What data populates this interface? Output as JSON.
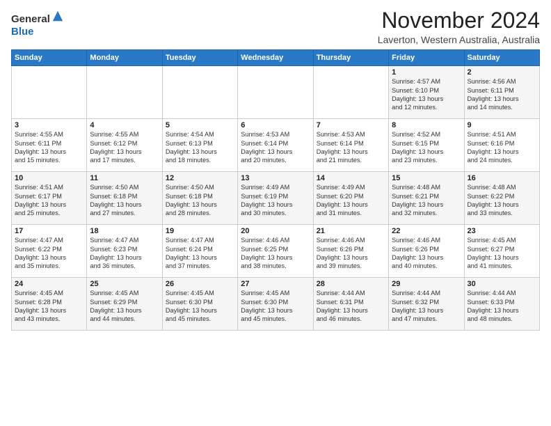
{
  "header": {
    "logo_line1": "General",
    "logo_line2": "Blue",
    "title": "November 2024",
    "subtitle": "Laverton, Western Australia, Australia"
  },
  "columns": [
    "Sunday",
    "Monday",
    "Tuesday",
    "Wednesday",
    "Thursday",
    "Friday",
    "Saturday"
  ],
  "weeks": [
    [
      {
        "day": "",
        "info": ""
      },
      {
        "day": "",
        "info": ""
      },
      {
        "day": "",
        "info": ""
      },
      {
        "day": "",
        "info": ""
      },
      {
        "day": "",
        "info": ""
      },
      {
        "day": "1",
        "info": "Sunrise: 4:57 AM\nSunset: 6:10 PM\nDaylight: 13 hours\nand 12 minutes."
      },
      {
        "day": "2",
        "info": "Sunrise: 4:56 AM\nSunset: 6:11 PM\nDaylight: 13 hours\nand 14 minutes."
      }
    ],
    [
      {
        "day": "3",
        "info": "Sunrise: 4:55 AM\nSunset: 6:11 PM\nDaylight: 13 hours\nand 15 minutes."
      },
      {
        "day": "4",
        "info": "Sunrise: 4:55 AM\nSunset: 6:12 PM\nDaylight: 13 hours\nand 17 minutes."
      },
      {
        "day": "5",
        "info": "Sunrise: 4:54 AM\nSunset: 6:13 PM\nDaylight: 13 hours\nand 18 minutes."
      },
      {
        "day": "6",
        "info": "Sunrise: 4:53 AM\nSunset: 6:14 PM\nDaylight: 13 hours\nand 20 minutes."
      },
      {
        "day": "7",
        "info": "Sunrise: 4:53 AM\nSunset: 6:14 PM\nDaylight: 13 hours\nand 21 minutes."
      },
      {
        "day": "8",
        "info": "Sunrise: 4:52 AM\nSunset: 6:15 PM\nDaylight: 13 hours\nand 23 minutes."
      },
      {
        "day": "9",
        "info": "Sunrise: 4:51 AM\nSunset: 6:16 PM\nDaylight: 13 hours\nand 24 minutes."
      }
    ],
    [
      {
        "day": "10",
        "info": "Sunrise: 4:51 AM\nSunset: 6:17 PM\nDaylight: 13 hours\nand 25 minutes."
      },
      {
        "day": "11",
        "info": "Sunrise: 4:50 AM\nSunset: 6:18 PM\nDaylight: 13 hours\nand 27 minutes."
      },
      {
        "day": "12",
        "info": "Sunrise: 4:50 AM\nSunset: 6:18 PM\nDaylight: 13 hours\nand 28 minutes."
      },
      {
        "day": "13",
        "info": "Sunrise: 4:49 AM\nSunset: 6:19 PM\nDaylight: 13 hours\nand 30 minutes."
      },
      {
        "day": "14",
        "info": "Sunrise: 4:49 AM\nSunset: 6:20 PM\nDaylight: 13 hours\nand 31 minutes."
      },
      {
        "day": "15",
        "info": "Sunrise: 4:48 AM\nSunset: 6:21 PM\nDaylight: 13 hours\nand 32 minutes."
      },
      {
        "day": "16",
        "info": "Sunrise: 4:48 AM\nSunset: 6:22 PM\nDaylight: 13 hours\nand 33 minutes."
      }
    ],
    [
      {
        "day": "17",
        "info": "Sunrise: 4:47 AM\nSunset: 6:22 PM\nDaylight: 13 hours\nand 35 minutes."
      },
      {
        "day": "18",
        "info": "Sunrise: 4:47 AM\nSunset: 6:23 PM\nDaylight: 13 hours\nand 36 minutes."
      },
      {
        "day": "19",
        "info": "Sunrise: 4:47 AM\nSunset: 6:24 PM\nDaylight: 13 hours\nand 37 minutes."
      },
      {
        "day": "20",
        "info": "Sunrise: 4:46 AM\nSunset: 6:25 PM\nDaylight: 13 hours\nand 38 minutes."
      },
      {
        "day": "21",
        "info": "Sunrise: 4:46 AM\nSunset: 6:26 PM\nDaylight: 13 hours\nand 39 minutes."
      },
      {
        "day": "22",
        "info": "Sunrise: 4:46 AM\nSunset: 6:26 PM\nDaylight: 13 hours\nand 40 minutes."
      },
      {
        "day": "23",
        "info": "Sunrise: 4:45 AM\nSunset: 6:27 PM\nDaylight: 13 hours\nand 41 minutes."
      }
    ],
    [
      {
        "day": "24",
        "info": "Sunrise: 4:45 AM\nSunset: 6:28 PM\nDaylight: 13 hours\nand 43 minutes."
      },
      {
        "day": "25",
        "info": "Sunrise: 4:45 AM\nSunset: 6:29 PM\nDaylight: 13 hours\nand 44 minutes."
      },
      {
        "day": "26",
        "info": "Sunrise: 4:45 AM\nSunset: 6:30 PM\nDaylight: 13 hours\nand 45 minutes."
      },
      {
        "day": "27",
        "info": "Sunrise: 4:45 AM\nSunset: 6:30 PM\nDaylight: 13 hours\nand 45 minutes."
      },
      {
        "day": "28",
        "info": "Sunrise: 4:44 AM\nSunset: 6:31 PM\nDaylight: 13 hours\nand 46 minutes."
      },
      {
        "day": "29",
        "info": "Sunrise: 4:44 AM\nSunset: 6:32 PM\nDaylight: 13 hours\nand 47 minutes."
      },
      {
        "day": "30",
        "info": "Sunrise: 4:44 AM\nSunset: 6:33 PM\nDaylight: 13 hours\nand 48 minutes."
      }
    ]
  ]
}
